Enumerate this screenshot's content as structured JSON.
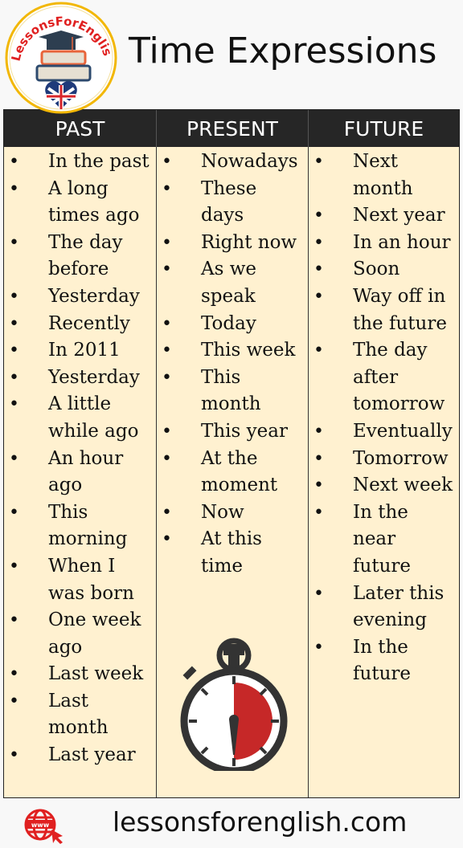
{
  "header": {
    "logo_text": "LessonsForEnglish.Com",
    "title": "Time Expressions"
  },
  "colors": {
    "header_bg": "#262626",
    "cell_bg": "#fff1d0",
    "accent_red": "#e02020",
    "stopwatch_red": "#c62828",
    "logo_ring": "#f2b705"
  },
  "table": {
    "columns": [
      {
        "heading": "PAST",
        "items": [
          "In the past",
          "A long times ago",
          "The day before",
          "Yesterday",
          "Recently",
          "In 2011",
          "Yesterday",
          "A little while ago",
          "An hour ago",
          "This morning",
          "When I was born",
          "One week ago",
          "Last week",
          "Last month",
          "Last year"
        ]
      },
      {
        "heading": "PRESENT",
        "items": [
          "Nowadays",
          "These days",
          "Right now",
          "As we speak",
          "Today",
          "This week",
          "This month",
          "This year",
          "At the moment",
          "Now",
          "At this time"
        ]
      },
      {
        "heading": "FUTURE",
        "items": [
          "Next month",
          "Next year",
          "In an hour",
          "Soon",
          "Way off in the future",
          "The day after tomorrow",
          "Eventually",
          "Tomorrow",
          "Next week",
          "In the near future",
          "Later this evening",
          "In the future"
        ]
      }
    ]
  },
  "illustration": {
    "icon": "stopwatch-icon",
    "elapsed_fraction": 0.5
  },
  "footer": {
    "icon": "www-globe-icon",
    "website": "lessonsforenglish.com"
  }
}
